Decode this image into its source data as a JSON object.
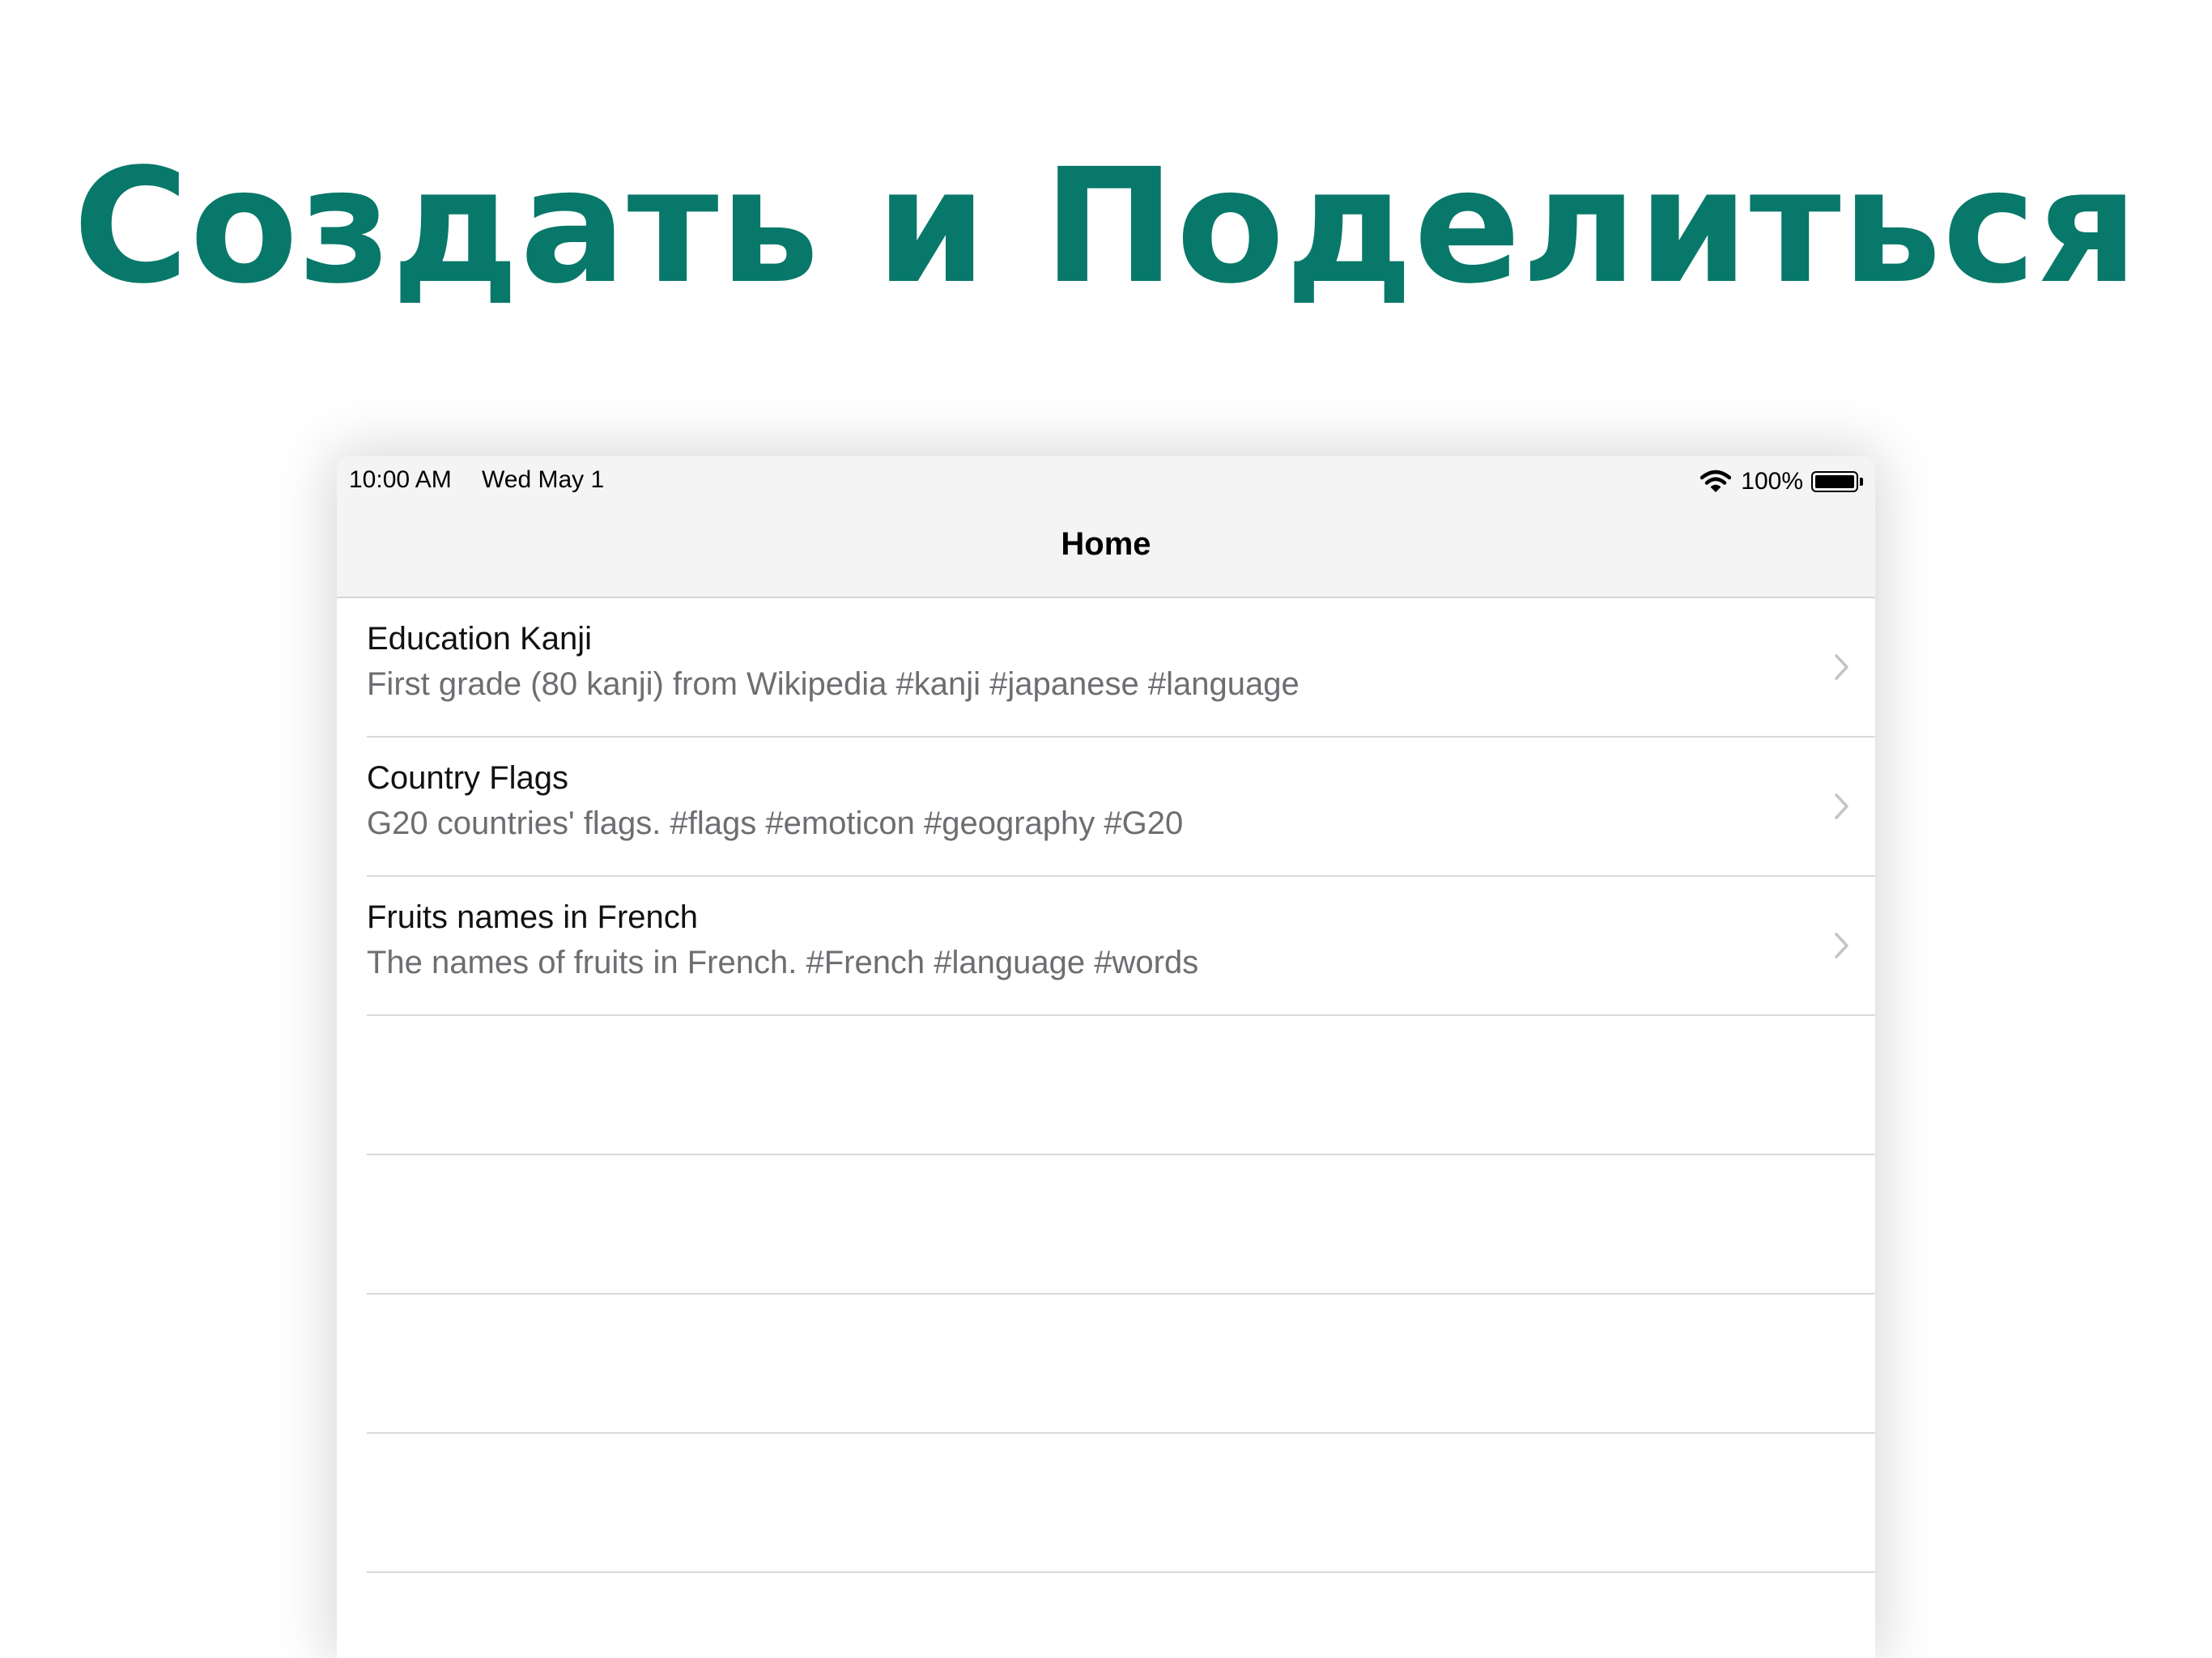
{
  "promo": {
    "headline": "Создать и Поделиться"
  },
  "status_bar": {
    "time": "10:00 AM",
    "date": "Wed May 1",
    "battery_percent": "100%",
    "battery_level": 1.0,
    "wifi_icon": "wifi-icon",
    "battery_icon": "battery-icon"
  },
  "nav": {
    "title": "Home"
  },
  "items": [
    {
      "title": "Education Kanji",
      "subtitle": "First grade (80 kanji) from Wikipedia #kanji #japanese #language"
    },
    {
      "title": "Country Flags",
      "subtitle": "G20 countries' flags. #flags #emoticon #geography #G20"
    },
    {
      "title": "Fruits names in French",
      "subtitle": "The names of fruits in French. #French #language #words"
    }
  ],
  "colors": {
    "headline": "#08786a",
    "subtitle": "#6d6d72",
    "nav_background": "#f4f4f4",
    "separator": "#d9d9dc",
    "chevron": "#c4c4c7"
  }
}
